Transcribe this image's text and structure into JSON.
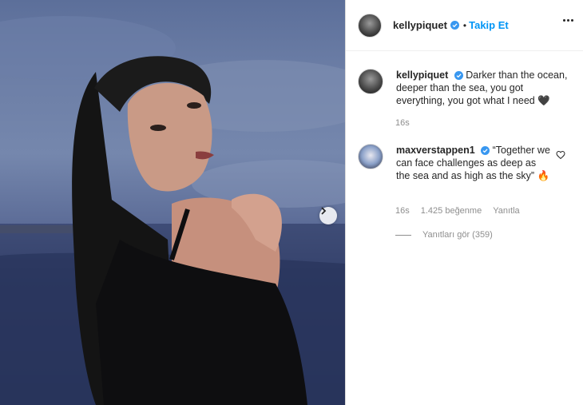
{
  "post": {
    "username": "kellypiquet",
    "separator": "•",
    "follow_label": "Takip Et"
  },
  "caption": {
    "username": "kellypiquet",
    "text": "Darker than the ocean, deeper than the sea, you got everything, you got what I need 🖤",
    "time": "16s"
  },
  "comments": [
    {
      "username": "maxverstappen1",
      "text": "“Together we can face challenges as deep as the sea and as high as the sky” 🔥",
      "time": "16s",
      "likes": "1.425 beğenme",
      "reply_label": "Yanıtla",
      "view_replies": "Yanıtları gör (359)"
    }
  ],
  "colors": {
    "accent": "#0095f6",
    "muted": "#8e8e8e",
    "verified": "#3897f0"
  },
  "icons": [
    "verified-badge-icon",
    "more-options-icon",
    "heart-icon",
    "chevron-right-icon"
  ]
}
